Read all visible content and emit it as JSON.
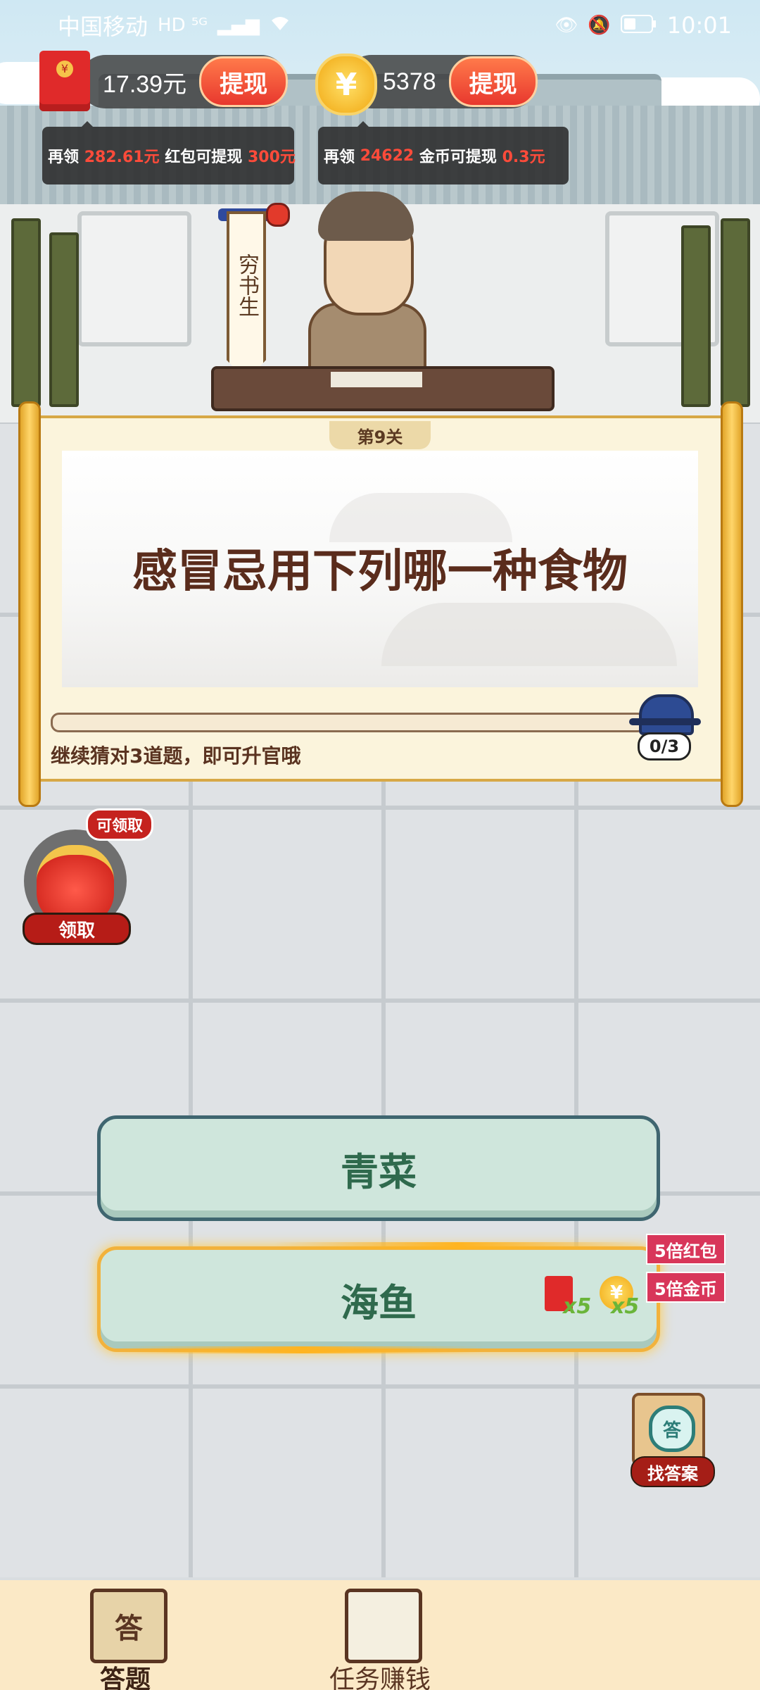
{
  "status_bar": {
    "carrier": "中国移动",
    "network_badges": "HD ⁵ᴳ",
    "signal": "▂▄▆",
    "wifi": "wifi-icon",
    "time": "10:01"
  },
  "balances": {
    "redpacket_amount": "17.39元",
    "redpacket_withdraw": "提现",
    "coin_amount": "5378",
    "coin_withdraw": "提现",
    "coin_symbol": "¥"
  },
  "hints": {
    "redpacket_prefix": "再领",
    "redpacket_value": "282.61元",
    "redpacket_mid": "红包可提现",
    "redpacket_target": "300元",
    "coin_prefix": "再领",
    "coin_value": "24622",
    "coin_mid": "金币可提现",
    "coin_target": "0.3元"
  },
  "character": {
    "title": "穷书生"
  },
  "quiz": {
    "level": "第9关",
    "question": "感冒忌用下列哪一种食物",
    "progress_fraction": 0.0,
    "progress_text": "0/3",
    "hint": "继续猜对3道题，即可升官哦"
  },
  "lucky_bag": {
    "badge": "可领取",
    "button": "领取"
  },
  "options": [
    {
      "label": "青菜"
    },
    {
      "label": "海鱼"
    }
  ],
  "bonus": {
    "redpacket_multiplier": "x5",
    "coin_multiplier": "x5",
    "redpacket_tag": "5倍红包",
    "coin_tag": "5倍金币"
  },
  "find_answer": {
    "icon_text": "答",
    "label": "找答案"
  },
  "bottom_nav": {
    "items": [
      {
        "label": "答题",
        "icon_text": "答",
        "active": true
      },
      {
        "label": "任务赚钱",
        "active": false
      }
    ]
  },
  "colors": {
    "accent_red": "#e8382e",
    "option_green": "#cfe6dc",
    "option_text": "#2f6a4d",
    "question_text": "#5a2c1c"
  }
}
